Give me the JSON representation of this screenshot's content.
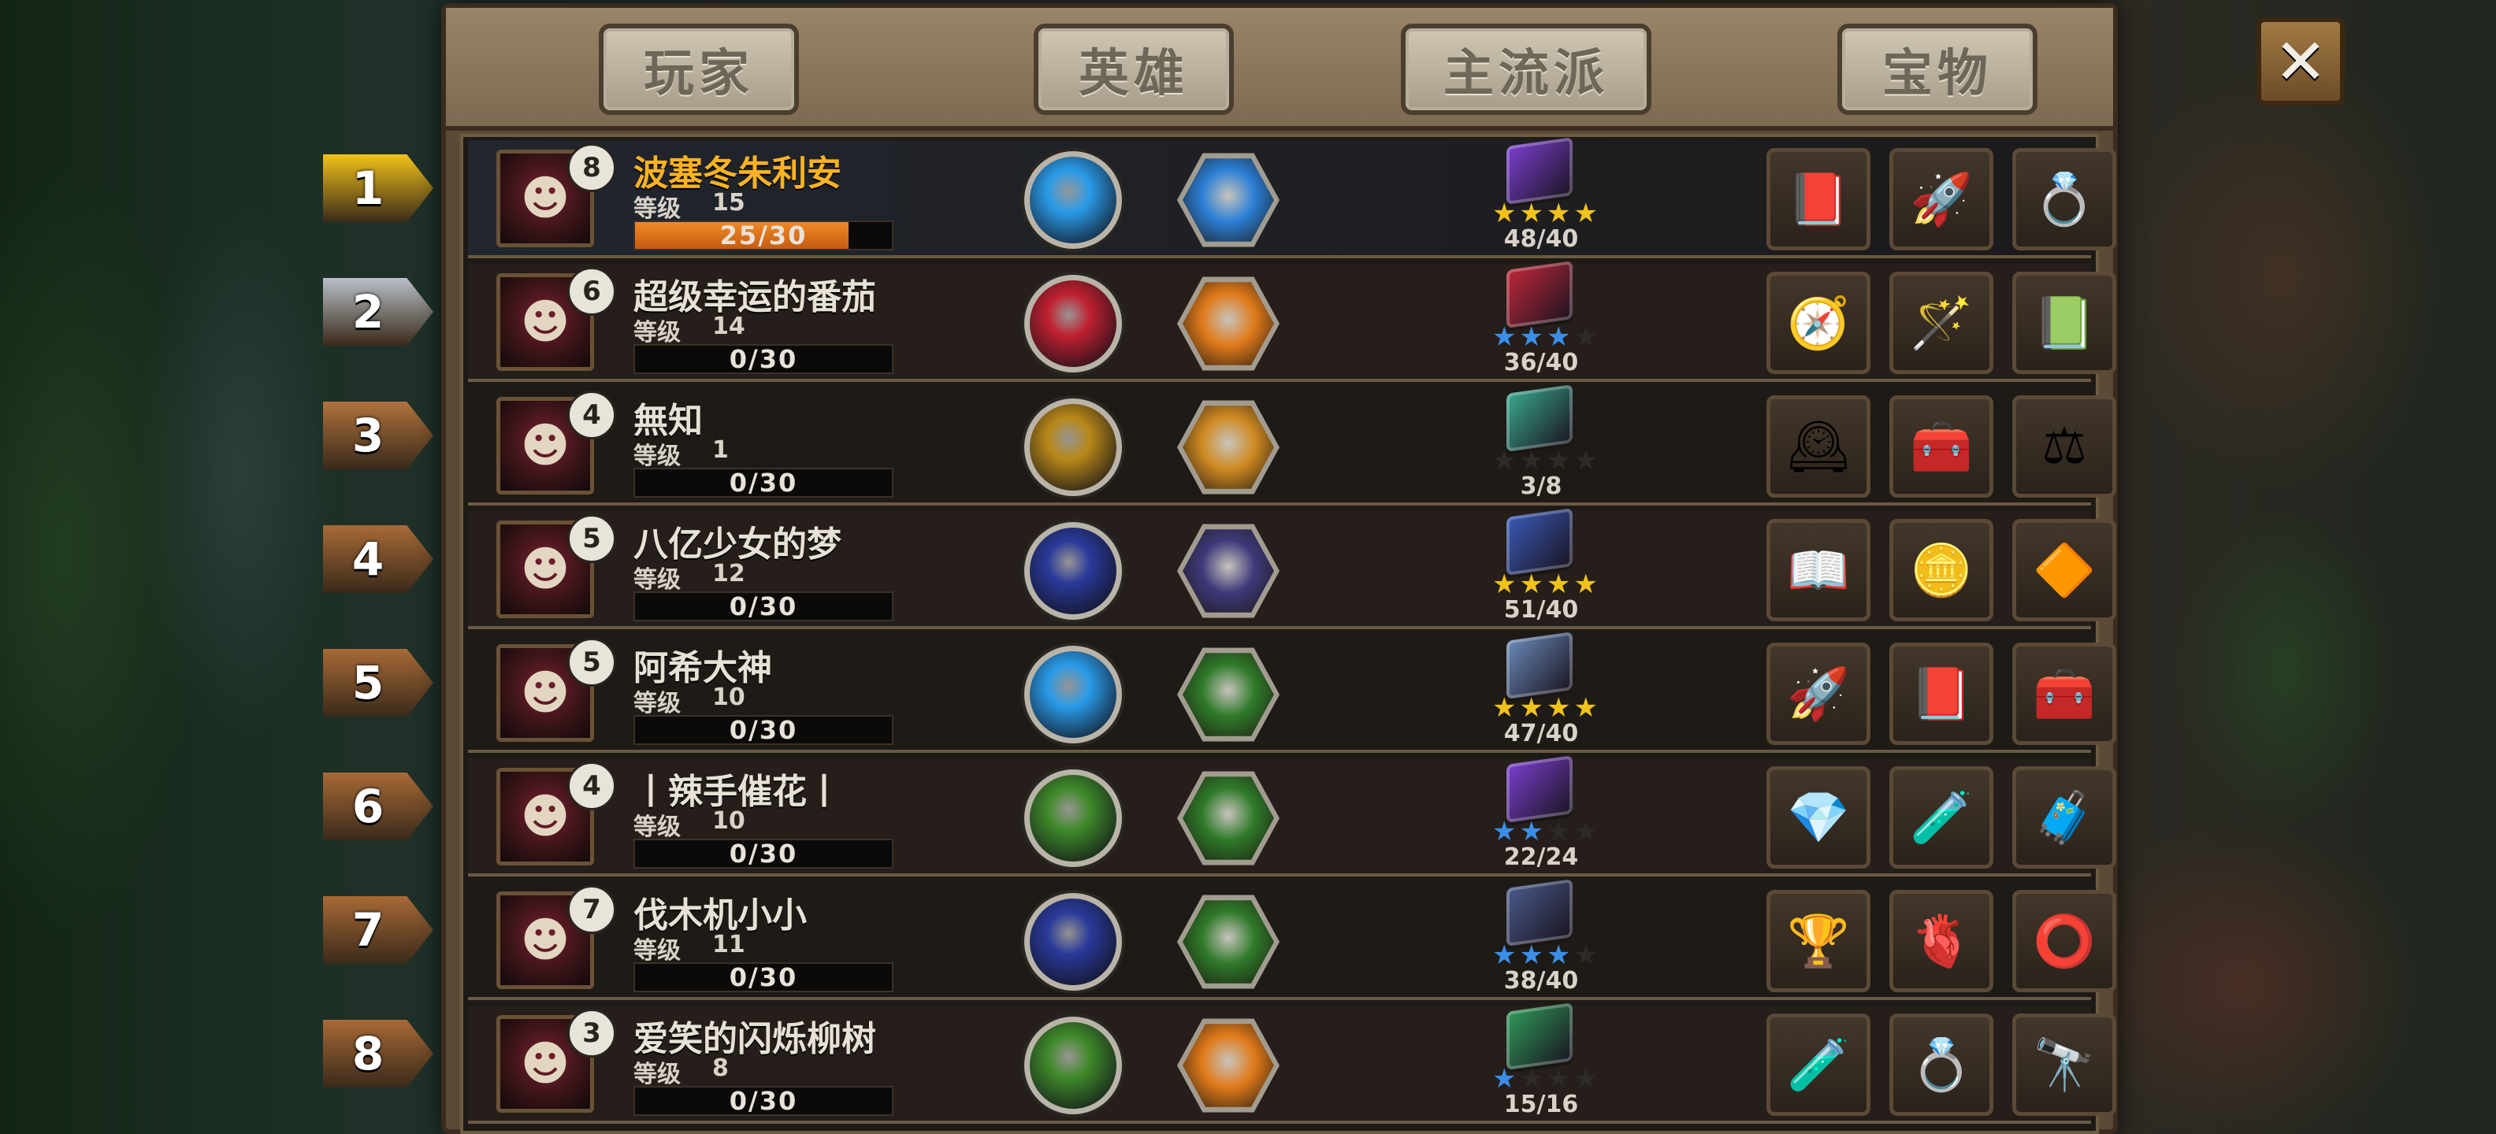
{
  "tabs": [
    "玩家",
    "英雄",
    "主流派",
    "宝物"
  ],
  "close_label": "✕",
  "level_label": "等级",
  "rows": [
    {
      "rank": "1",
      "rank_color": "#f2c21a",
      "name": "波塞冬朱利安",
      "name_gold": true,
      "badge": "8",
      "level": "15",
      "progress": "25/30",
      "progress_fraction": 0.83,
      "avatar_icon": "sea-maiden-icon",
      "hero_icon": "blue-vortex-orb-icon",
      "hero_color": "#2a9be8",
      "class_icon": "blue-swirl-hex-icon",
      "class_color": "#2b7fd6",
      "book_color": "#7b3fd0",
      "stars": 4,
      "stars_max": 4,
      "star_color": "#f1c21b",
      "count": "48/40",
      "treasures": [
        "spell-book-icon",
        "red-rocket-icon",
        "gold-ring-icon"
      ],
      "treasure_glyphs": [
        "📕",
        "🚀",
        "💍"
      ]
    },
    {
      "rank": "2",
      "rank_color": "#b9c0c8",
      "name": "超级幸运的番茄",
      "name_gold": false,
      "badge": "6",
      "level": "14",
      "progress": "0/30",
      "progress_fraction": 0,
      "avatar_icon": "red-warrior-icon",
      "hero_icon": "red-vortex-orb-icon",
      "hero_color": "#c02030",
      "class_icon": "fire-hex-icon",
      "class_color": "#e07a1a",
      "book_color": "#c0283a",
      "stars": 3,
      "stars_max": 4,
      "star_color": "#3a8ee8",
      "count": "36/40",
      "treasures": [
        "compass-icon",
        "golden-staff-icon",
        "green-book-icon"
      ],
      "treasure_glyphs": [
        "🧭",
        "🪄",
        "📗"
      ]
    },
    {
      "rank": "3",
      "rank_color": "#b0723c",
      "name": "無知",
      "name_gold": false,
      "badge": "4",
      "level": "1",
      "progress": "0/30",
      "progress_fraction": 0,
      "avatar_icon": "goblin-hat-icon",
      "hero_icon": "gold-coins-orb-icon",
      "hero_color": "#b88818",
      "class_icon": "gold-coin-hex-icon",
      "class_color": "#d08a22",
      "book_color": "#3aa88e",
      "stars": 0,
      "stars_max": 4,
      "star_color": "#3a3a3a",
      "count": "3/8",
      "treasures": [
        "clock-dial-icon",
        "first-aid-kit-icon",
        "balance-scale-icon"
      ],
      "treasure_glyphs": [
        "🕰",
        "🧰",
        "⚖"
      ]
    },
    {
      "rank": "4",
      "rank_color": "#a86a36",
      "name": "八亿少女的梦",
      "name_gold": false,
      "badge": "5",
      "level": "12",
      "progress": "0/30",
      "progress_fraction": 0,
      "avatar_icon": "blue-knight-icon",
      "hero_icon": "blue-robe-orb-icon",
      "hero_color": "#2a3a9a",
      "class_icon": "tornado-hex-icon",
      "class_color": "#3e3a7a",
      "book_color": "#3a5ab8",
      "stars": 4,
      "stars_max": 4,
      "star_color": "#f1c21b",
      "count": "51/40",
      "treasures": [
        "open-grimoire-icon",
        "gold-ingot-icon",
        "amber-crystal-icon"
      ],
      "treasure_glyphs": [
        "📖",
        "🪙",
        "🔶"
      ]
    },
    {
      "rank": "5",
      "rank_color": "#a86a36",
      "name": "阿希大神",
      "name_gold": false,
      "badge": "5",
      "level": "10",
      "progress": "0/30",
      "progress_fraction": 0,
      "avatar_icon": "hooded-reaper-icon",
      "hero_icon": "blue-vortex-orb-icon",
      "hero_color": "#2a9be8",
      "class_icon": "green-wind-hex-icon",
      "class_color": "#2f7a2a",
      "book_color": "#6a8ab8",
      "stars": 4,
      "stars_max": 4,
      "star_color": "#f1c21b",
      "count": "47/40",
      "treasures": [
        "red-rocket-icon",
        "spell-book-icon",
        "treasure-chest-icon"
      ],
      "treasure_glyphs": [
        "🚀",
        "📕",
        "🧰"
      ]
    },
    {
      "rank": "6",
      "rank_color": "#a86a36",
      "name": "丨辣手催花丨",
      "name_gold": false,
      "badge": "4",
      "level": "10",
      "progress": "0/30",
      "progress_fraction": 0,
      "avatar_icon": "armored-ranger-icon",
      "hero_icon": "green-trident-orb-icon",
      "hero_color": "#3f8a2a",
      "class_icon": "green-wind-hex-icon",
      "class_color": "#2f7a2a",
      "book_color": "#7b3fd0",
      "stars": 2,
      "stars_max": 4,
      "star_color": "#3a8ee8",
      "count": "22/24",
      "treasures": [
        "green-gem-icon",
        "purple-potion-icon",
        "blue-chest-icon"
      ],
      "treasure_glyphs": [
        "💎",
        "🧪",
        "🧳"
      ]
    },
    {
      "rank": "7",
      "rank_color": "#a86a36",
      "name": "伐木机小小",
      "name_gold": false,
      "badge": "7",
      "level": "11",
      "progress": "0/30",
      "progress_fraction": 0,
      "avatar_icon": "hooded-reaper-icon",
      "hero_icon": "blue-robe-orb-icon",
      "hero_color": "#2a3a9a",
      "class_icon": "green-wind-hex-icon",
      "class_color": "#2f7a2a",
      "book_color": "#4a5a8a",
      "stars": 3,
      "stars_max": 4,
      "star_color": "#3a8ee8",
      "count": "38/40",
      "treasures": [
        "golden-goblet-icon",
        "red-heart-icon",
        "iron-ring-icon"
      ],
      "treasure_glyphs": [
        "🏆",
        "🫀",
        "⭕"
      ]
    },
    {
      "rank": "8",
      "rank_color": "#a86a36",
      "name": "爱笑的闪烁柳树",
      "name_gold": false,
      "badge": "3",
      "level": "8",
      "progress": "0/30",
      "progress_fraction": 0,
      "avatar_icon": "hooded-reaper-icon",
      "hero_icon": "green-trident-orb-icon",
      "hero_color": "#3f8a2a",
      "class_icon": "fire-hex-icon",
      "class_color": "#e07a1a",
      "book_color": "#2f9a5a",
      "stars": 1,
      "stars_max": 4,
      "star_color": "#3a8ee8",
      "count": "15/16",
      "treasures": [
        "purple-potion-icon",
        "gold-ring-icon",
        "telescope-icon"
      ],
      "treasure_glyphs": [
        "🧪",
        "💍",
        "🔭"
      ]
    }
  ]
}
